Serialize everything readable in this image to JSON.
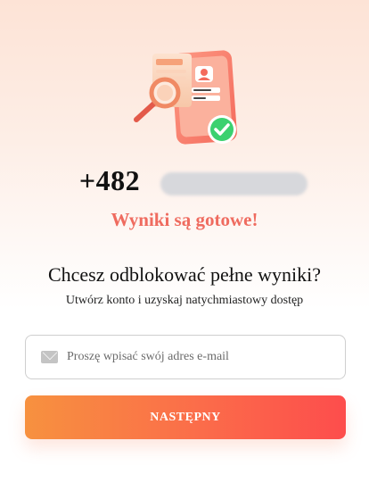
{
  "header": {
    "phone_number_visible": "+482",
    "results_status": "Wyniki są gotowe!"
  },
  "unlock": {
    "title": "Chcesz odblokować pełne wyniki?",
    "subtitle": "Utwórz konto i uzyskaj natychmiastowy dostęp"
  },
  "form": {
    "email_icon": "mail-icon",
    "email_placeholder": "Proszę wpisać swój adres e-mail",
    "email_value": "",
    "submit_label": "NASTĘPNY"
  },
  "colors": {
    "accent_red": "#ef6b5f",
    "button_gradient_start": "#f7913f",
    "button_gradient_end": "#fd4d4c",
    "check_green": "#3bd16f"
  }
}
